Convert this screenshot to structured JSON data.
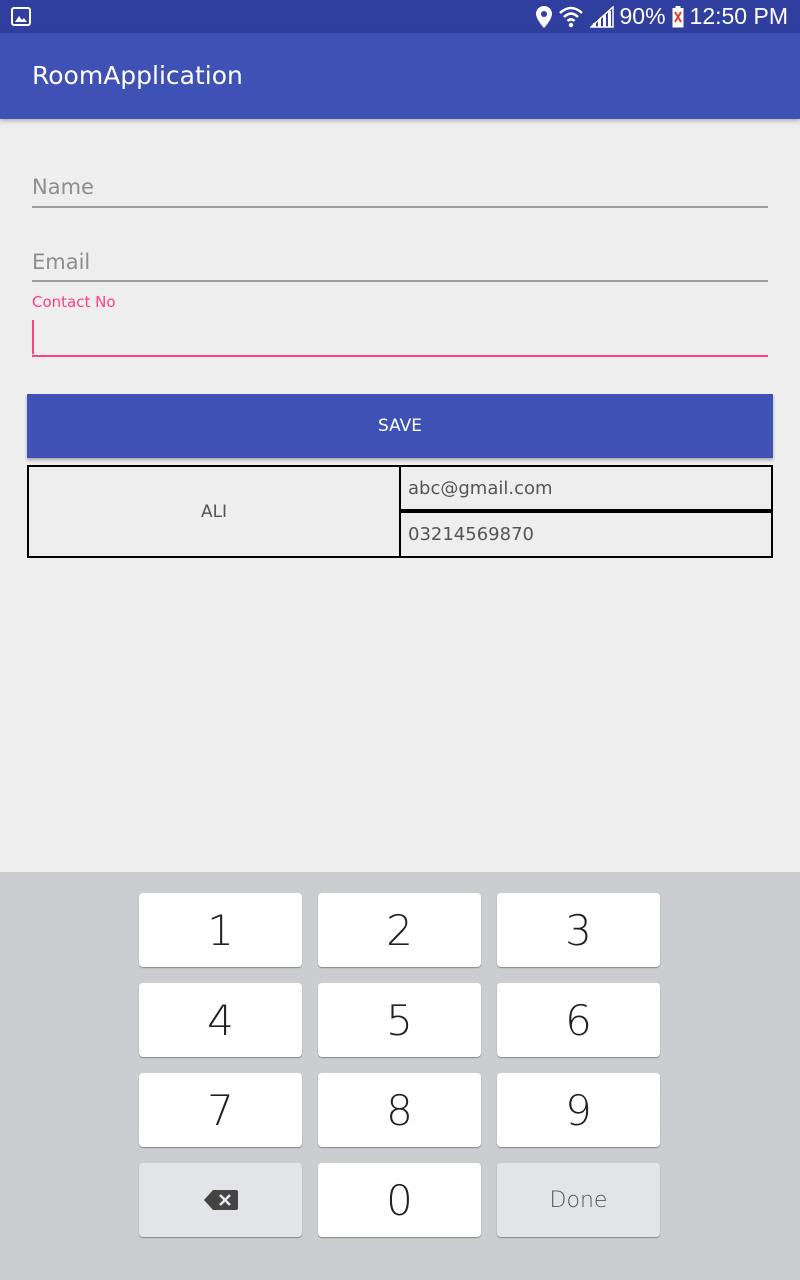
{
  "status_bar": {
    "battery": "90%",
    "time": "12:50 PM"
  },
  "app_bar": {
    "title": "RoomApplication"
  },
  "form": {
    "name_placeholder": "Name",
    "email_placeholder": "Email",
    "contact_label": "Contact No",
    "contact_value": ""
  },
  "save_label": "SAVE",
  "record": {
    "name": "ALI",
    "email": "abc@gmail.com",
    "contact": "03214569870"
  },
  "keyboard": {
    "keys": [
      "1",
      "2",
      "3",
      "4",
      "5",
      "6",
      "7",
      "8",
      "9",
      "0"
    ],
    "done_label": "Done",
    "backspace_icon": "backspace-icon"
  },
  "colors": {
    "primary": "#3f51b5",
    "primary_dark": "#303f9f",
    "accent": "#ff4081",
    "keyboard_bg": "#cbcdd1"
  }
}
